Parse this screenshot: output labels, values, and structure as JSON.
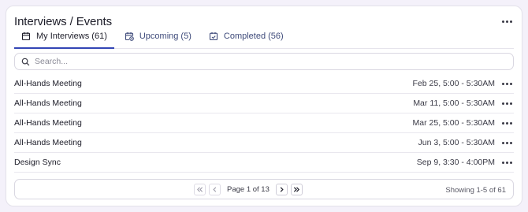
{
  "header": {
    "title": "Interviews / Events"
  },
  "tabs": [
    {
      "label": "My Interviews (61)",
      "icon": "calendar-icon",
      "active": true
    },
    {
      "label": "Upcoming (5)",
      "icon": "calendar-clock-icon",
      "active": false
    },
    {
      "label": "Completed (56)",
      "icon": "calendar-check-icon",
      "active": false
    }
  ],
  "search": {
    "placeholder": "Search...",
    "value": ""
  },
  "rows": [
    {
      "name": "All-Hands Meeting",
      "time": "Feb 25, 5:00 - 5:30AM"
    },
    {
      "name": "All-Hands Meeting",
      "time": "Mar 11, 5:00 - 5:30AM"
    },
    {
      "name": "All-Hands Meeting",
      "time": "Mar 25, 5:00 - 5:30AM"
    },
    {
      "name": "All-Hands Meeting",
      "time": "Jun 3, 5:00 - 5:30AM"
    },
    {
      "name": "Design Sync",
      "time": "Sep 9, 3:30 - 4:00PM"
    }
  ],
  "pagination": {
    "page_info": "Page 1 of 13",
    "showing": "Showing 1-5 of 61"
  },
  "colors": {
    "accent": "#3346b5",
    "tab_text": "#3e4a7a",
    "border": "#d9d7e1"
  }
}
